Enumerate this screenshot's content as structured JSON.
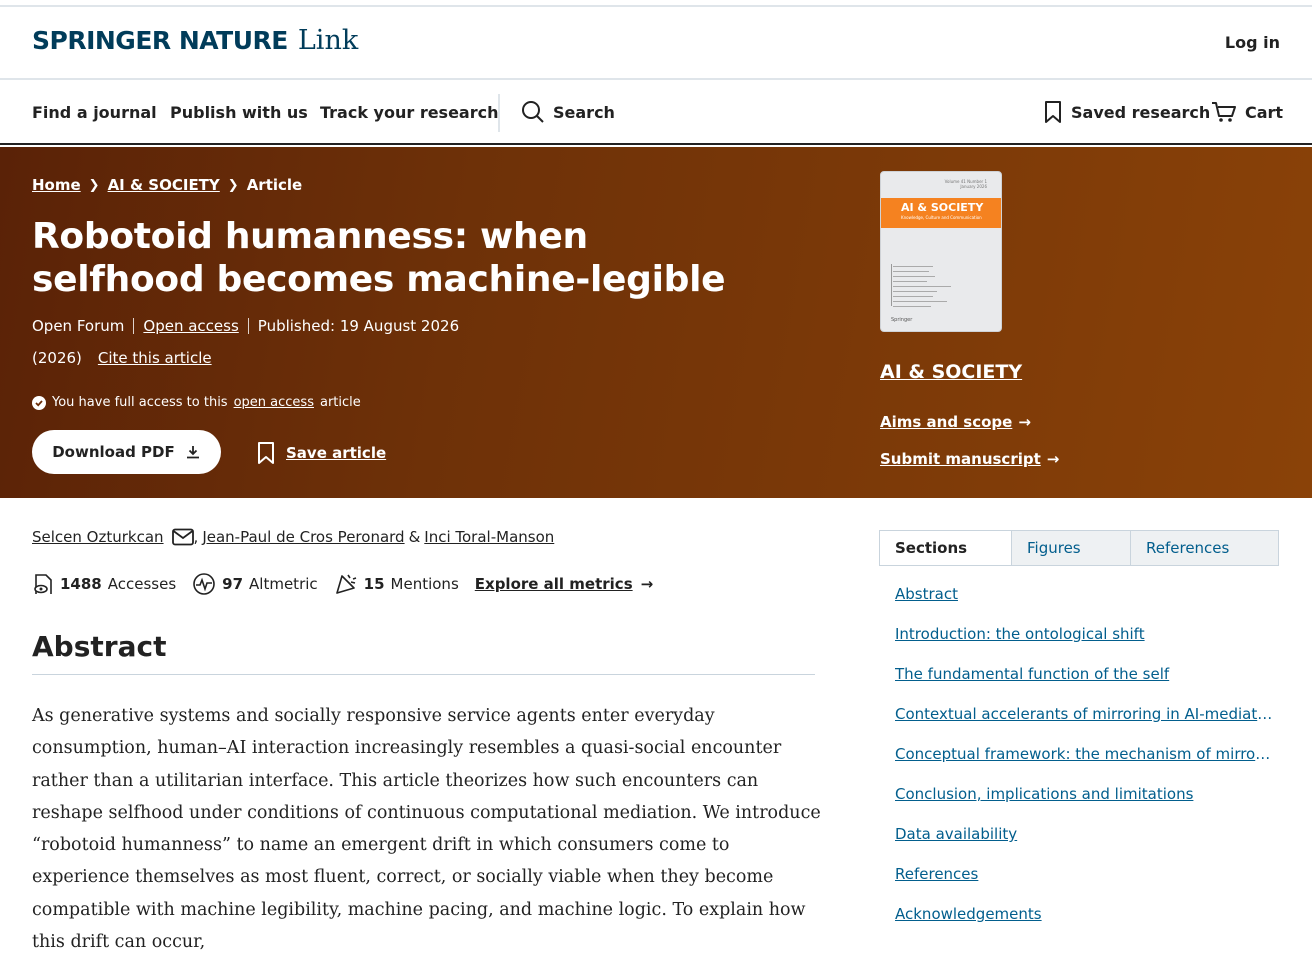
{
  "header": {
    "brand": "SPRINGER NATURE",
    "brand_link": "Link",
    "login": "Log in"
  },
  "nav": {
    "find_journal": "Find a journal",
    "publish": "Publish with us",
    "track": "Track your research",
    "search": "Search",
    "saved": "Saved research",
    "cart": "Cart"
  },
  "breadcrumb": {
    "home": "Home",
    "journal": "AI & SOCIETY",
    "current": "Article"
  },
  "article": {
    "title": "Robotoid humanness: when selfhood becomes machine-legible",
    "type": "Open Forum",
    "access": "Open access",
    "published": "Published: 19 August 2026",
    "year": "(2026)",
    "cite": "Cite this article",
    "access_prefix": "You have full access to this",
    "access_link": "open access",
    "access_suffix": "article",
    "download_pdf": "Download PDF",
    "save_article": "Save article"
  },
  "journal": {
    "name": "AI & SOCIETY",
    "cover_title": "AI & SOCIETY",
    "cover_subtitle": "Knowledge, Culture and Communication",
    "cover_issue": "Volume 41 Number 1",
    "cover_date": "January 2026",
    "cover_publisher": "Springer",
    "aims": "Aims and scope",
    "submit": "Submit manuscript"
  },
  "authors": {
    "a1": "Selcen Ozturkcan",
    "a2": "Jean-Paul de Cros Peronard",
    "sep": ",",
    "amp": "&",
    "a3": "Inci Toral-Manson"
  },
  "metrics": {
    "accesses_count": "1488",
    "accesses_label": "Accesses",
    "altmetric_count": "97",
    "altmetric_label": "Altmetric",
    "mentions_count": "15",
    "mentions_label": "Mentions",
    "explore": "Explore all metrics"
  },
  "abstract": {
    "heading": "Abstract",
    "text": "As generative systems and socially responsive service agents enter everyday consumption, human–AI interaction increasingly resembles a quasi-social encounter rather than a utilitarian interface. This article theorizes how such encounters can reshape selfhood under conditions of continuous computational mediation. We introduce “robotoid humanness” to name an emergent drift in which consumers come to experience themselves as most fluent, correct, or socially viable when they become compatible with machine legibility, machine pacing, and machine logic. To explain how this drift can occur,"
  },
  "sidebar": {
    "tabs": [
      "Sections",
      "Figures",
      "References"
    ],
    "sections": [
      "Abstract",
      "Introduction: the ontological shift",
      "The fundamental function of the self",
      "Contextual accelerants of mirroring in AI-mediated consumption",
      "Conceptual framework: the mechanism of mirroring",
      "Conclusion, implications and limitations",
      "Data availability",
      "References",
      "Acknowledgements"
    ]
  },
  "colors": {
    "brand": "#013c5a",
    "hero_start": "#5a2207",
    "hero_end": "#8a4208",
    "link": "#025e8d",
    "cover_band": "#f58220"
  }
}
